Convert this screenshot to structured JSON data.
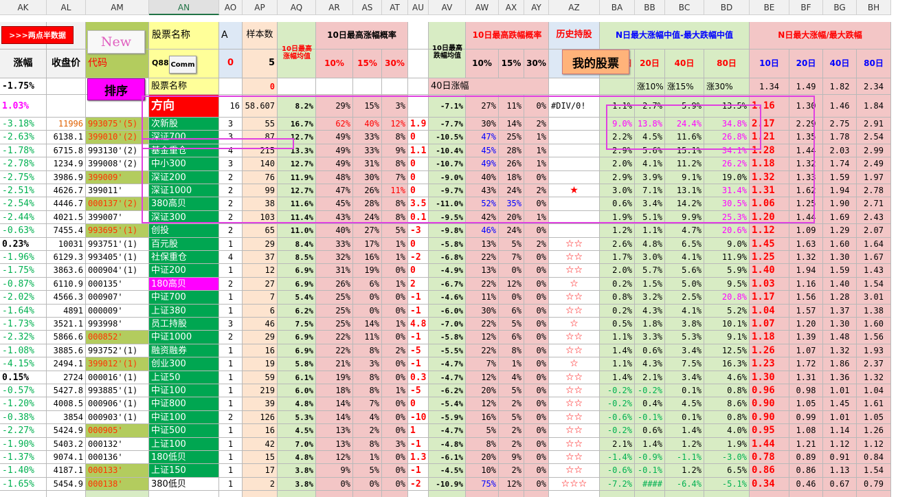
{
  "col_letters": [
    "AK",
    "AL",
    "AM",
    "AN",
    "AO",
    "AP",
    "AQ",
    "AR",
    "AS",
    "AT",
    "AU",
    "AV",
    "AW",
    "AX",
    "AY",
    "AZ",
    "BA",
    "BB",
    "BC",
    "BD",
    "BE",
    "BF",
    "BG",
    "BH"
  ],
  "buttons": {
    "liangdian": ">>>两点半数据",
    "new": "New",
    "paixu": "排序",
    "comm": "Comm",
    "wode": "我的股票"
  },
  "header": {
    "zhangfu": "涨幅",
    "shoupanjia": "收盘价",
    "daima": "代码",
    "gupiao_mingcheng": "股票名称",
    "a": "A",
    "yangbenshu": "样本数",
    "q88": "Q88",
    "zero": "0",
    "five": "5",
    "ten_max_avg": "10日最高涨幅均值",
    "ten_max_prob": "10日最高涨幅概率",
    "ten_min_avg": "10日最高跌幅均值",
    "ten_min_prob": "10日最高跌幅概率",
    "lishi": "历史持股",
    "median_diff": "N日最大涨幅中值-最大跌幅中值",
    "ratio": "N日最大涨幅/最大跌幅",
    "p10": "10%",
    "p15": "15%",
    "p30": "30%",
    "ri": "日",
    "d10": "10日",
    "d20": "20日",
    "d40": "40日",
    "d80": "80日"
  },
  "row3": {
    "ak": "-1.75%",
    "an": "股票名称",
    "ap": "0",
    "av": "40日涨幅",
    "bb": "涨10%",
    "bc": "涨15%",
    "bd": "涨30%",
    "be": "1.34",
    "bf": "1.49",
    "bg": "1.82",
    "bh": "2.34"
  },
  "row4": {
    "ak": "1.03%",
    "an": "方向",
    "ao": "16",
    "ap": "58.607",
    "aq": "8.2%",
    "ar": "29%",
    "as": "15%",
    "at": "3%",
    "av": "-7.1%",
    "aw": "27%",
    "ax": "11%",
    "ay": "0%",
    "az": "#DIV/0!",
    "ba": "1.1%",
    "bb": "2.7%",
    "bc": "5.9%",
    "bd": "13.5%",
    "be": "1.16",
    "bf": "1.30",
    "bg": "1.46",
    "bh": "1.84"
  },
  "rows": [
    {
      "ak": "-3.18%",
      "al": "11996",
      "am": "993075'(5)",
      "an": "次新股",
      "ao": "3",
      "ap": "55",
      "aq": "16.7%",
      "ar": "62%",
      "as": "40%",
      "at": "12%",
      "au": "1.9",
      "av": "-7.7%",
      "aw": "30%",
      "ax": "14%",
      "ay": "2%",
      "az": "",
      "ba": "9.0%",
      "bb": "13.8%",
      "bc": "24.4%",
      "bd": "34.8%",
      "be": "2.17",
      "bf": "2.29",
      "bg": "2.75",
      "bh": "2.91"
    },
    {
      "ak": "-2.63%",
      "al": "6138.1",
      "am": "399010'(2)",
      "an": "深证700",
      "ao": "3",
      "ap": "87",
      "aq": "12.7%",
      "ar": "49%",
      "as": "33%",
      "at": "8%",
      "au": "0",
      "av": "-10.5%",
      "aw": "47%",
      "ax": "25%",
      "ay": "1%",
      "az": "",
      "ba": "2.2%",
      "bb": "4.5%",
      "bc": "11.6%",
      "bd": "26.8%",
      "be": "1.21",
      "bf": "1.35",
      "bg": "1.78",
      "bh": "2.54"
    },
    {
      "ak": "-1.78%",
      "al": "6715.8",
      "am": "993130'(2)",
      "an": "基金重仓",
      "ao": "4",
      "ap": "215",
      "aq": "13.3%",
      "ar": "49%",
      "as": "33%",
      "at": "9%",
      "au": "1.1",
      "av": "-10.4%",
      "aw": "45%",
      "ax": "28%",
      "ay": "1%",
      "az": "",
      "ba": "2.9%",
      "bb": "5.6%",
      "bc": "15.1%",
      "bd": "34.1%",
      "be": "1.28",
      "bf": "1.44",
      "bg": "2.03",
      "bh": "2.99"
    },
    {
      "ak": "-2.78%",
      "al": "1234.9",
      "am": "399008'(2)",
      "an": "中小300",
      "ao": "3",
      "ap": "140",
      "aq": "12.7%",
      "ar": "49%",
      "as": "31%",
      "at": "8%",
      "au": "0",
      "av": "-10.7%",
      "aw": "49%",
      "ax": "26%",
      "ay": "1%",
      "az": "",
      "ba": "2.0%",
      "bb": "4.1%",
      "bc": "11.2%",
      "bd": "26.2%",
      "be": "1.18",
      "bf": "1.32",
      "bg": "1.74",
      "bh": "2.49"
    },
    {
      "ak": "-2.75%",
      "al": "3986.9",
      "am": "399009'",
      "an": "深证200",
      "ao": "2",
      "ap": "76",
      "aq": "11.9%",
      "ar": "48%",
      "as": "30%",
      "at": "7%",
      "au": "0",
      "av": "-9.0%",
      "aw": "40%",
      "ax": "18%",
      "ay": "0%",
      "az": "",
      "ba": "2.9%",
      "bb": "3.9%",
      "bc": "9.1%",
      "bd": "19.0%",
      "be": "1.32",
      "bf": "1.33",
      "bg": "1.59",
      "bh": "1.97"
    },
    {
      "ak": "-2.51%",
      "al": "4626.7",
      "am": "399011'",
      "an": "深证1000",
      "ao": "2",
      "ap": "99",
      "aq": "12.7%",
      "ar": "47%",
      "as": "26%",
      "at": "11%",
      "au": "0",
      "av": "-9.7%",
      "aw": "43%",
      "ax": "24%",
      "ay": "2%",
      "az": "★",
      "ba": "3.0%",
      "bb": "7.1%",
      "bc": "13.1%",
      "bd": "31.4%",
      "be": "1.31",
      "bf": "1.62",
      "bg": "1.94",
      "bh": "2.78"
    },
    {
      "ak": "-2.54%",
      "al": "4446.7",
      "am": "000137'(2)",
      "an": "380高贝",
      "ao": "2",
      "ap": "38",
      "aq": "11.6%",
      "ar": "45%",
      "as": "28%",
      "at": "8%",
      "au": "3.5",
      "av": "-11.0%",
      "aw": "52%",
      "ax": "35%",
      "ay": "0%",
      "az": "",
      "ba": "0.6%",
      "bb": "3.4%",
      "bc": "14.2%",
      "bd": "30.5%",
      "be": "1.06",
      "bf": "1.25",
      "bg": "1.90",
      "bh": "2.71"
    },
    {
      "ak": "-2.44%",
      "al": "4021.5",
      "am": "399007'",
      "an": "深证300",
      "ao": "2",
      "ap": "103",
      "aq": "11.4%",
      "ar": "43%",
      "as": "24%",
      "at": "8%",
      "au": "0.1",
      "av": "-9.5%",
      "aw": "42%",
      "ax": "20%",
      "ay": "1%",
      "az": "",
      "ba": "1.9%",
      "bb": "5.1%",
      "bc": "9.9%",
      "bd": "25.3%",
      "be": "1.20",
      "bf": "1.44",
      "bg": "1.69",
      "bh": "2.43"
    },
    {
      "ak": "-0.63%",
      "al": "7455.4",
      "am": "993695'(1)",
      "an": "创投",
      "ao": "2",
      "ap": "65",
      "aq": "11.0%",
      "ar": "40%",
      "as": "27%",
      "at": "5%",
      "au": "-3",
      "av": "-9.8%",
      "aw": "46%",
      "ax": "24%",
      "ay": "0%",
      "az": "",
      "ba": "1.2%",
      "bb": "1.1%",
      "bc": "4.7%",
      "bd": "20.6%",
      "be": "1.12",
      "bf": "1.09",
      "bg": "1.29",
      "bh": "2.07"
    },
    {
      "ak": "0.23%",
      "al": "10031",
      "am": "993751'(1)",
      "an": "百元股",
      "ao": "1",
      "ap": "29",
      "aq": "8.4%",
      "ar": "33%",
      "as": "17%",
      "at": "1%",
      "au": "0",
      "av": "-5.8%",
      "aw": "13%",
      "ax": "5%",
      "ay": "2%",
      "az": "☆☆",
      "ba": "2.6%",
      "bb": "4.8%",
      "bc": "6.5%",
      "bd": "9.0%",
      "be": "1.45",
      "bf": "1.63",
      "bg": "1.60",
      "bh": "1.64"
    },
    {
      "ak": "-1.96%",
      "al": "6129.3",
      "am": "993405'(1)",
      "an": "社保重仓",
      "ao": "4",
      "ap": "37",
      "aq": "8.5%",
      "ar": "32%",
      "as": "16%",
      "at": "1%",
      "au": "-2",
      "av": "-6.8%",
      "aw": "22%",
      "ax": "7%",
      "ay": "0%",
      "az": "☆☆",
      "ba": "1.7%",
      "bb": "3.0%",
      "bc": "4.1%",
      "bd": "11.9%",
      "be": "1.25",
      "bf": "1.32",
      "bg": "1.30",
      "bh": "1.67"
    },
    {
      "ak": "-1.75%",
      "al": "3863.6",
      "am": "000904'(1)",
      "an": "中证200",
      "ao": "1",
      "ap": "12",
      "aq": "6.9%",
      "ar": "31%",
      "as": "19%",
      "at": "0%",
      "au": "0",
      "av": "-4.9%",
      "aw": "13%",
      "ax": "0%",
      "ay": "0%",
      "az": "☆☆",
      "ba": "2.0%",
      "bb": "5.7%",
      "bc": "5.6%",
      "bd": "5.9%",
      "be": "1.40",
      "bf": "1.94",
      "bg": "1.59",
      "bh": "1.43"
    },
    {
      "ak": "-0.87%",
      "al": "6110.9",
      "am": "000135'",
      "an": "180高贝",
      "ao": "2",
      "ap": "27",
      "aq": "6.9%",
      "ar": "26%",
      "as": "6%",
      "at": "1%",
      "au": "2",
      "av": "-6.7%",
      "aw": "22%",
      "ax": "12%",
      "ay": "0%",
      "az": "☆",
      "ba": "0.2%",
      "bb": "1.5%",
      "bc": "5.0%",
      "bd": "9.5%",
      "be": "1.03",
      "bf": "1.16",
      "bg": "1.40",
      "bh": "1.54"
    },
    {
      "ak": "-2.02%",
      "al": "4566.3",
      "am": "000907'",
      "an": "中证700",
      "ao": "1",
      "ap": "7",
      "aq": "5.4%",
      "ar": "25%",
      "as": "0%",
      "at": "0%",
      "au": "-1",
      "av": "-4.6%",
      "aw": "11%",
      "ax": "0%",
      "ay": "0%",
      "az": "☆☆",
      "ba": "0.8%",
      "bb": "3.2%",
      "bc": "2.5%",
      "bd": "20.8%",
      "be": "1.17",
      "bf": "1.56",
      "bg": "1.28",
      "bh": "3.01"
    },
    {
      "ak": "-1.64%",
      "al": "4891",
      "am": "000009'",
      "an": "上证380",
      "ao": "1",
      "ap": "6",
      "aq": "6.2%",
      "ar": "25%",
      "as": "0%",
      "at": "0%",
      "au": "-1",
      "av": "-6.0%",
      "aw": "30%",
      "ax": "6%",
      "ay": "0%",
      "az": "☆☆",
      "ba": "0.2%",
      "bb": "4.3%",
      "bc": "4.1%",
      "bd": "5.2%",
      "be": "1.04",
      "bf": "1.57",
      "bg": "1.37",
      "bh": "1.38"
    },
    {
      "ak": "-1.73%",
      "al": "3521.1",
      "am": "993998'",
      "an": "员工持股",
      "ao": "3",
      "ap": "46",
      "aq": "7.5%",
      "ar": "25%",
      "as": "14%",
      "at": "1%",
      "au": "4.8",
      "av": "-7.0%",
      "aw": "22%",
      "ax": "5%",
      "ay": "0%",
      "az": "☆",
      "ba": "0.5%",
      "bb": "1.8%",
      "bc": "3.8%",
      "bd": "10.1%",
      "be": "1.07",
      "bf": "1.20",
      "bg": "1.30",
      "bh": "1.60"
    },
    {
      "ak": "-2.32%",
      "al": "5866.6",
      "am": "000852'",
      "an": "中证1000",
      "ao": "2",
      "ap": "29",
      "aq": "6.9%",
      "ar": "22%",
      "as": "11%",
      "at": "0%",
      "au": "-1",
      "av": "-5.8%",
      "aw": "12%",
      "ax": "6%",
      "ay": "0%",
      "az": "☆☆",
      "ba": "1.1%",
      "bb": "3.3%",
      "bc": "5.3%",
      "bd": "9.1%",
      "be": "1.18",
      "bf": "1.39",
      "bg": "1.48",
      "bh": "1.56"
    },
    {
      "ak": "-1.08%",
      "al": "3885.6",
      "am": "993752'(1)",
      "an": "融资融券",
      "ao": "1",
      "ap": "16",
      "aq": "6.9%",
      "ar": "22%",
      "as": "8%",
      "at": "2%",
      "au": "-5",
      "av": "-5.5%",
      "aw": "22%",
      "ax": "8%",
      "ay": "0%",
      "az": "☆☆",
      "ba": "1.4%",
      "bb": "0.6%",
      "bc": "3.4%",
      "bd": "12.5%",
      "be": "1.26",
      "bf": "1.07",
      "bg": "1.32",
      "bh": "1.93"
    },
    {
      "ak": "-4.15%",
      "al": "2494.1",
      "am": "399012'(1)",
      "an": "创业300",
      "ao": "1",
      "ap": "19",
      "aq": "5.8%",
      "ar": "21%",
      "as": "3%",
      "at": "0%",
      "au": "-1",
      "av": "-4.7%",
      "aw": "7%",
      "ax": "1%",
      "ay": "0%",
      "az": "☆",
      "ba": "1.1%",
      "bb": "4.3%",
      "bc": "7.5%",
      "bd": "16.3%",
      "be": "1.23",
      "bf": "1.72",
      "bg": "1.86",
      "bh": "2.37"
    },
    {
      "ak": "0.15%",
      "al": "2724",
      "am": "000016'(1)",
      "an": "上证50",
      "ao": "1",
      "ap": "59",
      "aq": "6.1%",
      "ar": "19%",
      "as": "8%",
      "at": "0%",
      "au": "0.3",
      "av": "-4.7%",
      "aw": "12%",
      "ax": "4%",
      "ay": "0%",
      "az": "☆☆",
      "ba": "1.4%",
      "bb": "2.1%",
      "bc": "3.4%",
      "bd": "4.6%",
      "be": "1.30",
      "bf": "1.31",
      "bg": "1.36",
      "bh": "1.32"
    },
    {
      "ak": "-0.57%",
      "al": "5427.8",
      "am": "993885'(1)",
      "an": "中证100",
      "ao": "1",
      "ap": "219",
      "aq": "6.0%",
      "ar": "18%",
      "as": "8%",
      "at": "1%",
      "au": "-5",
      "av": "-6.2%",
      "aw": "20%",
      "ax": "5%",
      "ay": "0%",
      "az": "☆☆",
      "ba": "-0.2%",
      "bb": "-0.2%",
      "bc": "0.1%",
      "bd": "0.8%",
      "be": "0.96",
      "bf": "0.98",
      "bg": "1.01",
      "bh": "1.04"
    },
    {
      "ak": "-1.20%",
      "al": "4008.5",
      "am": "000906'(1)",
      "an": "中证800",
      "ao": "1",
      "ap": "39",
      "aq": "4.8%",
      "ar": "14%",
      "as": "7%",
      "at": "0%",
      "au": "0",
      "av": "-5.4%",
      "aw": "12%",
      "ax": "2%",
      "ay": "0%",
      "az": "☆☆",
      "ba": "-0.2%",
      "bb": "0.4%",
      "bc": "4.5%",
      "bd": "8.6%",
      "be": "0.90",
      "bf": "1.05",
      "bg": "1.45",
      "bh": "1.61"
    },
    {
      "ak": "-0.38%",
      "al": "3854",
      "am": "000903'(1)",
      "an": "中证100",
      "ao": "2",
      "ap": "126",
      "aq": "5.3%",
      "ar": "14%",
      "as": "4%",
      "at": "0%",
      "au": "-10",
      "av": "-5.9%",
      "aw": "16%",
      "ax": "5%",
      "ay": "0%",
      "az": "☆☆",
      "ba": "-0.6%",
      "bb": "-0.1%",
      "bc": "0.1%",
      "bd": "0.8%",
      "be": "0.90",
      "bf": "0.99",
      "bg": "1.01",
      "bh": "1.05"
    },
    {
      "ak": "-2.27%",
      "al": "5424.9",
      "am": "000905'",
      "an": "中证500",
      "ao": "1",
      "ap": "16",
      "aq": "4.5%",
      "ar": "13%",
      "as": "2%",
      "at": "0%",
      "au": "1",
      "av": "-4.7%",
      "aw": "5%",
      "ax": "2%",
      "ay": "0%",
      "az": "☆☆",
      "ba": "-0.2%",
      "bb": "0.6%",
      "bc": "1.4%",
      "bd": "4.0%",
      "be": "0.95",
      "bf": "1.08",
      "bg": "1.14",
      "bh": "1.26"
    },
    {
      "ak": "-1.90%",
      "al": "5403.2",
      "am": "000132'",
      "an": "上证100",
      "ao": "1",
      "ap": "42",
      "aq": "7.0%",
      "ar": "13%",
      "as": "8%",
      "at": "3%",
      "au": "-1",
      "av": "-4.8%",
      "aw": "8%",
      "ax": "2%",
      "ay": "0%",
      "az": "☆☆",
      "ba": "2.1%",
      "bb": "1.4%",
      "bc": "1.2%",
      "bd": "1.9%",
      "be": "1.44",
      "bf": "1.21",
      "bg": "1.12",
      "bh": "1.12"
    },
    {
      "ak": "-1.37%",
      "al": "9074.1",
      "am": "000136'",
      "an": "180低贝",
      "ao": "1",
      "ap": "15",
      "aq": "4.8%",
      "ar": "12%",
      "as": "1%",
      "at": "0%",
      "au": "1.3",
      "av": "-6.1%",
      "aw": "20%",
      "ax": "9%",
      "ay": "0%",
      "az": "☆☆",
      "ba": "-1.4%",
      "bb": "-0.9%",
      "bc": "-1.1%",
      "bd": "-3.0%",
      "be": "0.78",
      "bf": "0.89",
      "bg": "0.91",
      "bh": "0.84"
    },
    {
      "ak": "-1.40%",
      "al": "4187.1",
      "am": "000133'",
      "an": "上证150",
      "ao": "1",
      "ap": "17",
      "aq": "3.8%",
      "ar": "9%",
      "as": "5%",
      "at": "0%",
      "au": "-1",
      "av": "-4.5%",
      "aw": "10%",
      "ax": "2%",
      "ay": "0%",
      "az": "☆☆",
      "ba": "-0.6%",
      "bb": "-0.1%",
      "bc": "1.2%",
      "bd": "6.5%",
      "be": "0.86",
      "bf": "0.86",
      "bg": "1.13",
      "bh": "1.54"
    },
    {
      "ak": "-1.65%",
      "al": "5454.9",
      "am": "000138'",
      "an": "380低贝",
      "ao": "1",
      "ap": "2",
      "aq": "3.8%",
      "ar": "0%",
      "as": "0%",
      "at": "0%",
      "au": "-2",
      "av": "-10.9%",
      "aw": "75%",
      "ax": "12%",
      "ay": "0%",
      "az": "☆☆☆",
      "ba": "-7.2%",
      "bb": "####",
      "bc": "-6.4%",
      "bd": "-5.1%",
      "be": "0.34",
      "bf": "0.46",
      "bg": "0.67",
      "bh": "0.79"
    }
  ],
  "colors": {
    "green_text": "#00b050",
    "red_text": "#ff0000",
    "magenta": "#ff00ff",
    "name_green": "#00a651",
    "pink_bg": "#f3c6c6",
    "peach_bg": "#fde4cf",
    "light_green_bg": "#d8ecc4",
    "light_blue_bg": "#dde8f5",
    "yellow_bg": "#ffff99",
    "olive_bg": "#b3cc5e",
    "red_bg": "#ff0000"
  }
}
